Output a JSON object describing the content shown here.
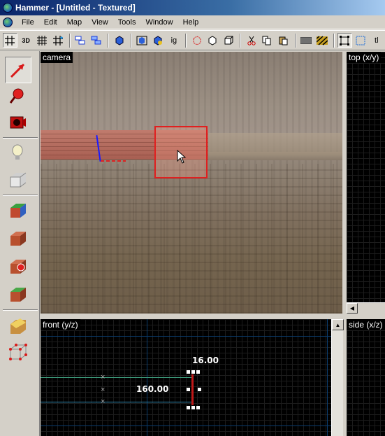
{
  "window": {
    "title": "Hammer - [Untitled - Textured]"
  },
  "menu": {
    "items": [
      "File",
      "Edit",
      "Map",
      "View",
      "Tools",
      "Window",
      "Help"
    ]
  },
  "toolbar": {
    "items": [
      {
        "icon": "grid-icon"
      },
      {
        "icon": "3d-grid-icon",
        "label": "3D"
      },
      {
        "icon": "smaller-grid-icon"
      },
      {
        "icon": "larger-grid-icon"
      },
      {
        "icon": "group-icon"
      },
      {
        "icon": "ungroup-icon"
      },
      {
        "icon": "hide-icon"
      },
      {
        "icon": "carve-icon"
      },
      {
        "icon": "entity-icon"
      },
      {
        "icon": "ignore-groups-icon",
        "label": "ig"
      },
      {
        "icon": "hollow-icon"
      },
      {
        "icon": "brush-icon"
      },
      {
        "icon": "box-icon"
      },
      {
        "icon": "cut-icon"
      },
      {
        "icon": "copy-icon"
      },
      {
        "icon": "paste-icon"
      },
      {
        "icon": "texture-icon"
      },
      {
        "icon": "texture-lock-icon"
      },
      {
        "icon": "select-box-icon"
      },
      {
        "icon": "select-dashed-icon"
      },
      {
        "icon": "tl-icon",
        "label": "tl"
      }
    ]
  },
  "tools": [
    {
      "icon": "selection-arrow-icon",
      "pressed": true
    },
    {
      "icon": "magnify-icon"
    },
    {
      "icon": "camera-icon"
    },
    {
      "icon": "entity-light-icon"
    },
    {
      "icon": "block-tool-icon"
    },
    {
      "icon": "texture-app-icon"
    },
    {
      "icon": "apply-texture-icon"
    },
    {
      "icon": "decal-icon"
    },
    {
      "icon": "overlay-icon"
    },
    {
      "icon": "clipping-icon"
    },
    {
      "icon": "vertex-icon"
    }
  ],
  "viewports": {
    "camera": {
      "label": "camera"
    },
    "top": {
      "label": "top (x/y)"
    },
    "front": {
      "label": "front (y/z)"
    },
    "side": {
      "label": "side (x/z)"
    }
  },
  "front_view": {
    "width_label": "16.00",
    "height_label": "160.00"
  },
  "colors": {
    "selection": "#e02020",
    "title_gradient_start": "#0a246a",
    "grid_major": "#0b3d6e"
  }
}
